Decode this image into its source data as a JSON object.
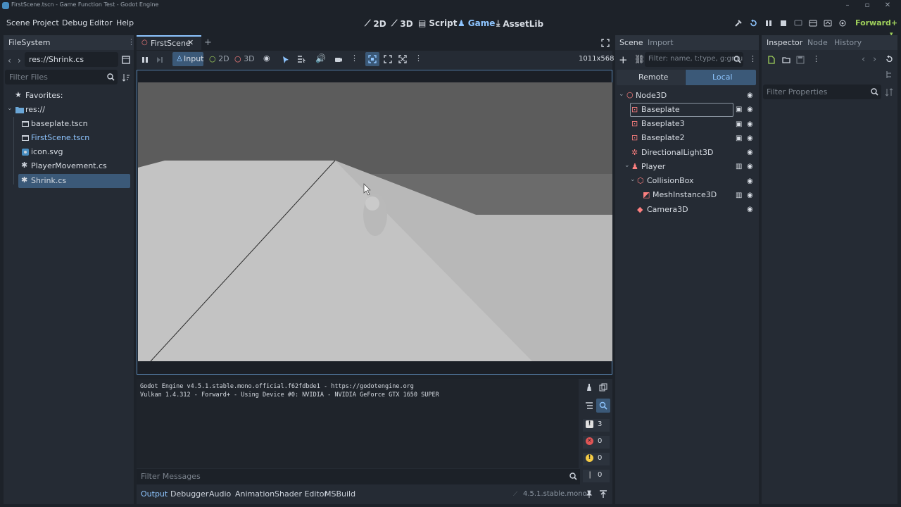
{
  "window": {
    "title": "FirstScene.tscn - Game Function Test - Godot Engine"
  },
  "menu": [
    "Scene",
    "Project",
    "Debug",
    "Editor",
    "Help"
  ],
  "workspaces": [
    {
      "label": "2D",
      "icon": "2d-icon"
    },
    {
      "label": "3D",
      "icon": "3d-icon"
    },
    {
      "label": "Script",
      "icon": "script-icon"
    },
    {
      "label": "Game",
      "icon": "game-icon"
    },
    {
      "label": "AssetLib",
      "icon": "assetlib-icon"
    }
  ],
  "renderer": "Forward+",
  "filesystem": {
    "tab": "FileSystem",
    "path": "res://Shrink.cs",
    "filter_placeholder": "Filter Files",
    "favorites": "Favorites:",
    "root": "res://",
    "files": [
      {
        "name": "baseplate.tscn",
        "icon": "scene-file-icon"
      },
      {
        "name": "FirstScene.tscn",
        "icon": "scene-file-icon"
      },
      {
        "name": "icon.svg",
        "icon": "image-file-icon"
      },
      {
        "name": "PlayerMovement.cs",
        "icon": "csharp-file-icon"
      },
      {
        "name": "Shrink.cs",
        "icon": "csharp-file-icon"
      }
    ]
  },
  "editor": {
    "scene_tab": "FirstScene",
    "toolbar": {
      "input": "Input",
      "mode_2d": "2D",
      "mode_3d": "3D",
      "resolution": "1011x568"
    }
  },
  "output": {
    "lines": [
      "Godot Engine v4.5.1.stable.mono.official.f62fdbde1 - https://godotengine.org",
      "Vulkan 1.4.312 - Forward+ - Using Device #0: NVIDIA - NVIDIA GeForce GTX 1650 SUPER"
    ],
    "filter_placeholder": "Filter Messages",
    "counts": {
      "messages": "3",
      "errors": "0",
      "warnings": "0",
      "other": "0"
    },
    "tabs": [
      "Output",
      "Debugger",
      "Audio",
      "Animation",
      "Shader Editor",
      "MSBuild"
    ],
    "version": "4.5.1.stable.mono"
  },
  "scene": {
    "tabs": [
      "Scene",
      "Import"
    ],
    "filter_placeholder": "Filter: name, t:type, g:grou",
    "remote": "Remote",
    "local": "Local",
    "nodes": [
      {
        "name": "Node3D"
      },
      {
        "name": "Baseplate"
      },
      {
        "name": "Baseplate3"
      },
      {
        "name": "Baseplate2"
      },
      {
        "name": "DirectionalLight3D"
      },
      {
        "name": "Player"
      },
      {
        "name": "CollisionBox"
      },
      {
        "name": "MeshInstance3D"
      },
      {
        "name": "Camera3D"
      }
    ]
  },
  "inspector": {
    "tabs": [
      "Inspector",
      "Node",
      "History"
    ],
    "filter_placeholder": "Filter Properties"
  },
  "colors": {
    "accent": "#8ec5ff",
    "node3d": "#fc7f7f",
    "selection": "#3b5978",
    "renderer": "#9fd05b"
  }
}
